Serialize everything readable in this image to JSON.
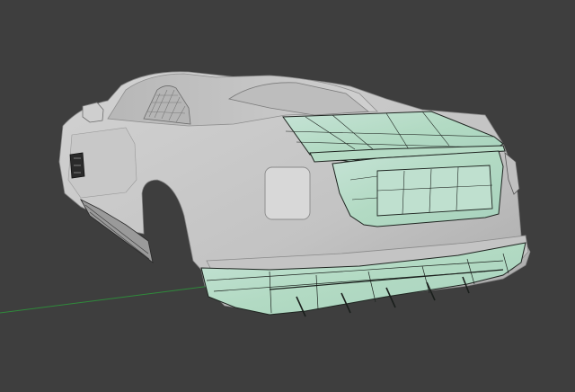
{
  "viewport": {
    "background_color": "#3e3e3e",
    "body_color": "#c9c9c9",
    "selected_face_color": "#b3dcc4",
    "wire_color": "#1e2420",
    "axis_color": "#2f8a3b"
  }
}
